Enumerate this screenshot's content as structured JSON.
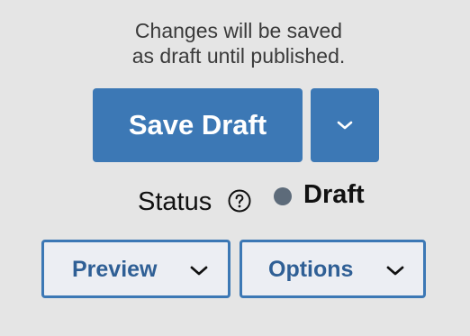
{
  "notice": {
    "line1": "Changes will be saved",
    "line2": "as draft until published."
  },
  "save": {
    "label": "Save Draft",
    "toggle_icon": "chevron-down-icon"
  },
  "status": {
    "label": "Status",
    "help_icon": "help-circle-icon",
    "value": "Draft",
    "dot_color": "#5d6b7a"
  },
  "actions": {
    "preview_label": "Preview",
    "options_label": "Options"
  },
  "colors": {
    "accent": "#3c78b5",
    "background": "#e5e5e5"
  }
}
